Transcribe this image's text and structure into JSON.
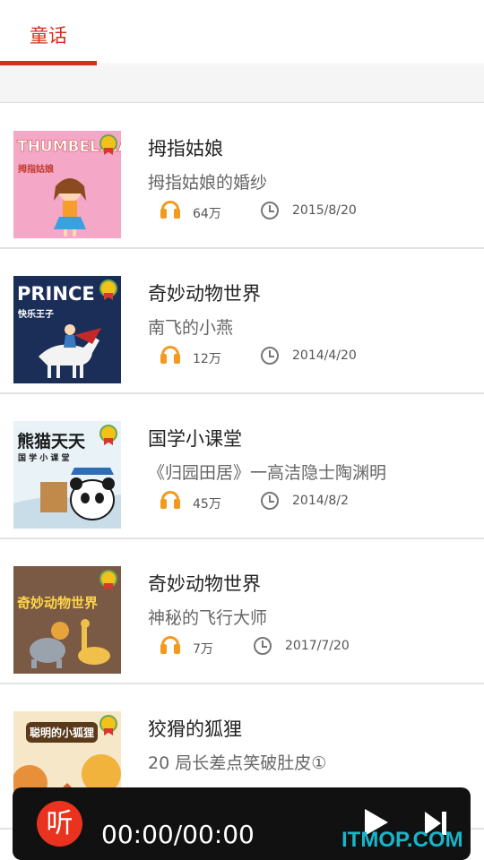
{
  "tabs": [
    {
      "label": "童话",
      "active": true
    }
  ],
  "accent_color": "#d32f1f",
  "items": [
    {
      "title": "拇指姑娘",
      "subtitle": "拇指姑娘的婚纱",
      "plays": "64万",
      "date": "2015/8/20",
      "cover_text": "THUMBELINA",
      "cover_sub": "拇指姑娘",
      "cover_color": "#f4a7c6"
    },
    {
      "title": "奇妙动物世界",
      "subtitle": "南飞的小燕",
      "plays": "12万",
      "date": "2014/4/20",
      "cover_text": "PRINCE",
      "cover_sub": "快乐王子",
      "cover_color": "#1b2e58"
    },
    {
      "title": "国学小课堂",
      "subtitle": "《归园田居》一高洁隐士陶渊明",
      "plays": "45万",
      "date": "2014/8/2",
      "cover_text": "熊猫天天",
      "cover_sub": "国 学 小 课 堂",
      "cover_color": "#e8f2f7"
    },
    {
      "title": "奇妙动物世界",
      "subtitle": "神秘的飞行大师",
      "plays": "7万",
      "date": "2017/7/20",
      "cover_text": "奇妙动物世界",
      "cover_sub": "",
      "cover_color": "#7a5a44"
    },
    {
      "title": "狡猾的狐狸",
      "subtitle": "20 局长差点笑破肚皮①",
      "plays": "",
      "date": "",
      "cover_text": "聪明的小狐狸",
      "cover_sub": "",
      "cover_color": "#f6e7c8"
    }
  ],
  "player": {
    "listen_label": "听",
    "time": "00:00/00:00"
  },
  "watermark": "ITMOP.COM"
}
